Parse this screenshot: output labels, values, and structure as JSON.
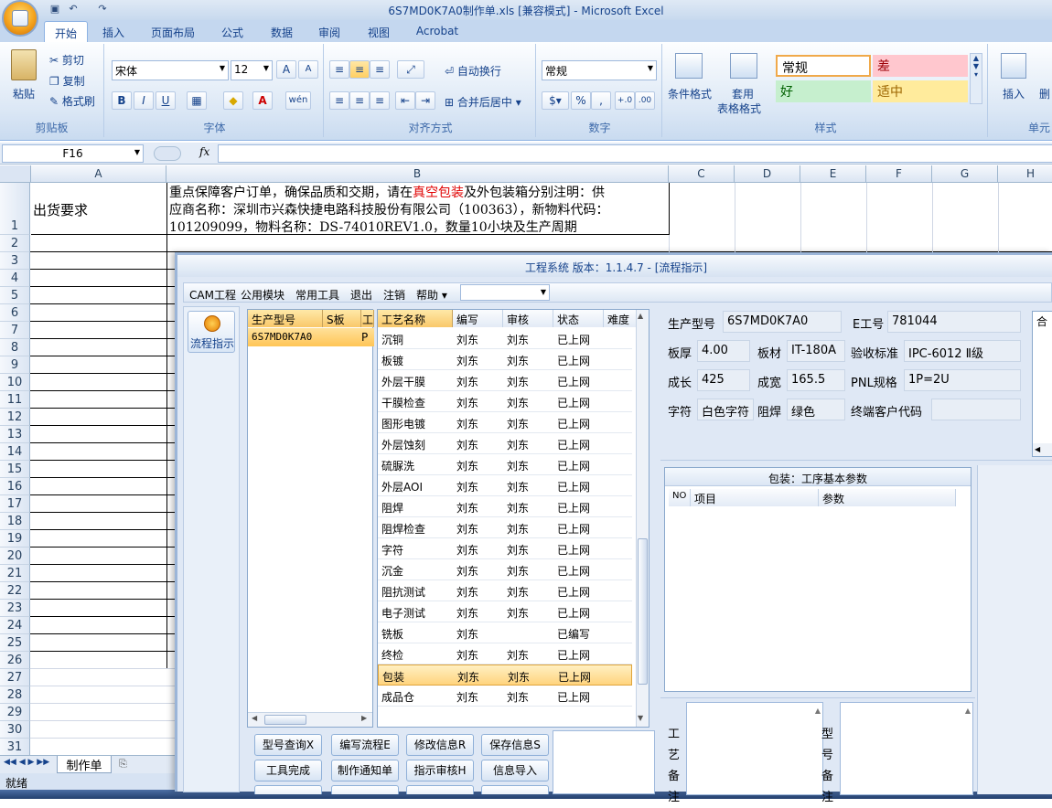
{
  "excel": {
    "title": "6S7MD0K7A0制作单.xls  [兼容模式] - Microsoft Excel",
    "tabs": [
      "开始",
      "插入",
      "页面布局",
      "公式",
      "数据",
      "审阅",
      "视图",
      "Acrobat"
    ],
    "clipboard": {
      "paste": "粘贴",
      "cut": "剪切",
      "copy": "复制",
      "format_painter": "格式刷",
      "label": "剪贴板"
    },
    "font": {
      "name": "宋体",
      "size": "12",
      "label": "字体",
      "bold": "B",
      "italic": "I",
      "underline": "U",
      "grow": "A",
      "shrink": "A",
      "wen": "wén"
    },
    "alignment": {
      "wrap": "自动换行",
      "merge": "合并后居中",
      "label": "对齐方式"
    },
    "number": {
      "format": "常规",
      "percent": "%",
      "comma": ",",
      "inc": "+.0",
      "dec": ".00",
      "label": "数字"
    },
    "styles": {
      "cond": "条件格式",
      "table1": "套用",
      "table2": "表格格式",
      "normal": "常规",
      "bad": "差",
      "good": "好",
      "neutral": "适中",
      "label": "样式"
    },
    "cells": {
      "insert": "插入",
      "delete": "删",
      "label": "单元"
    },
    "name_box": "F16",
    "fx": "fx",
    "columns": [
      "A",
      "B",
      "C",
      "D",
      "E",
      "F",
      "G",
      "H"
    ],
    "rows": [
      "1",
      "2",
      "3",
      "4",
      "5",
      "6",
      "7",
      "8",
      "9",
      "10",
      "11",
      "12",
      "13",
      "14",
      "15",
      "16",
      "17",
      "18",
      "19",
      "20",
      "21",
      "22",
      "23",
      "24",
      "25",
      "26",
      "27",
      "28",
      "29",
      "30",
      "31"
    ],
    "a1": "出货要求",
    "b1_pre": "重点保障客户订单，确保品质和交期，请在",
    "b1_red": "真空包装",
    "b1_post": "及外包装箱分别注明：供",
    "b1_line2": "应商名称：深圳市兴森快捷电路科技股份有限公司（100363），新物料代码：",
    "b1_line3": "101209099，物料名称：DS-74010REV1.0，数量10小块及生产周期",
    "sheet_tab": "制作单",
    "status": "就绪"
  },
  "app": {
    "title": "工程系统  版本：1.1.4.7 - [流程指示]",
    "menu": [
      "CAM工程",
      "公用模块",
      "常用工具",
      "退出",
      "注销",
      "帮助"
    ],
    "nav_item": "流程指示",
    "product_table": {
      "headers": [
        "生产型号",
        "S板",
        "工"
      ],
      "row": [
        "6S7MD0K7A0",
        "P"
      ]
    },
    "process_table": {
      "headers": [
        "工艺名称",
        "编写",
        "审核",
        "状态",
        "难度"
      ],
      "rows": [
        [
          "沉铜",
          "刘东",
          "刘东",
          "已上网"
        ],
        [
          "板镀",
          "刘东",
          "刘东",
          "已上网"
        ],
        [
          "外层干膜",
          "刘东",
          "刘东",
          "已上网"
        ],
        [
          "干膜检查",
          "刘东",
          "刘东",
          "已上网"
        ],
        [
          "图形电镀",
          "刘东",
          "刘东",
          "已上网"
        ],
        [
          "外层蚀刻",
          "刘东",
          "刘东",
          "已上网"
        ],
        [
          "硫脲洗",
          "刘东",
          "刘东",
          "已上网"
        ],
        [
          "外层AOI",
          "刘东",
          "刘东",
          "已上网"
        ],
        [
          "阻焊",
          "刘东",
          "刘东",
          "已上网"
        ],
        [
          "阻焊检查",
          "刘东",
          "刘东",
          "已上网"
        ],
        [
          "字符",
          "刘东",
          "刘东",
          "已上网"
        ],
        [
          "沉金",
          "刘东",
          "刘东",
          "已上网"
        ],
        [
          "阻抗测试",
          "刘东",
          "刘东",
          "已上网"
        ],
        [
          "电子测试",
          "刘东",
          "刘东",
          "已上网"
        ],
        [
          "铣板",
          "刘东",
          "",
          "已编写"
        ],
        [
          "终检",
          "刘东",
          "刘东",
          "已上网"
        ],
        [
          "包装",
          "刘东",
          "刘东",
          "已上网"
        ],
        [
          "成品仓",
          "刘东",
          "刘东",
          "已上网"
        ]
      ],
      "selected_index": 16
    },
    "info": {
      "model_label": "生产型号",
      "model": "6S7MD0K7A0",
      "eng_label": "E工号",
      "eng": "781044",
      "thick_label": "板厚",
      "thick": "4.00",
      "mat_label": "板材",
      "mat": "IT-180A",
      "std_label": "验收标准",
      "std": "IPC-6012 Ⅱ级",
      "len_label": "成长",
      "len": "425",
      "wid_label": "成宽",
      "wid": "165.5",
      "pnl_label": "PNL规格",
      "pnl": "1P=2U",
      "char_label": "字符",
      "char": "白色字符",
      "mask_label": "阻焊",
      "mask": "绿色",
      "cust_label": "终端客户代码",
      "cust": "",
      "side_label": "合"
    },
    "params": {
      "title": "包装：工序基本参数",
      "headers": [
        "NO",
        "项目",
        "参数"
      ]
    },
    "buttons_row1": [
      "型号查询X",
      "编写流程E",
      "修改信息R",
      "保存信息S"
    ],
    "buttons_row2": [
      "工具完成",
      "制作通知单",
      "指示审核H",
      "信息导入"
    ],
    "notes": {
      "process": "工艺备注",
      "model": "型号备注"
    }
  }
}
